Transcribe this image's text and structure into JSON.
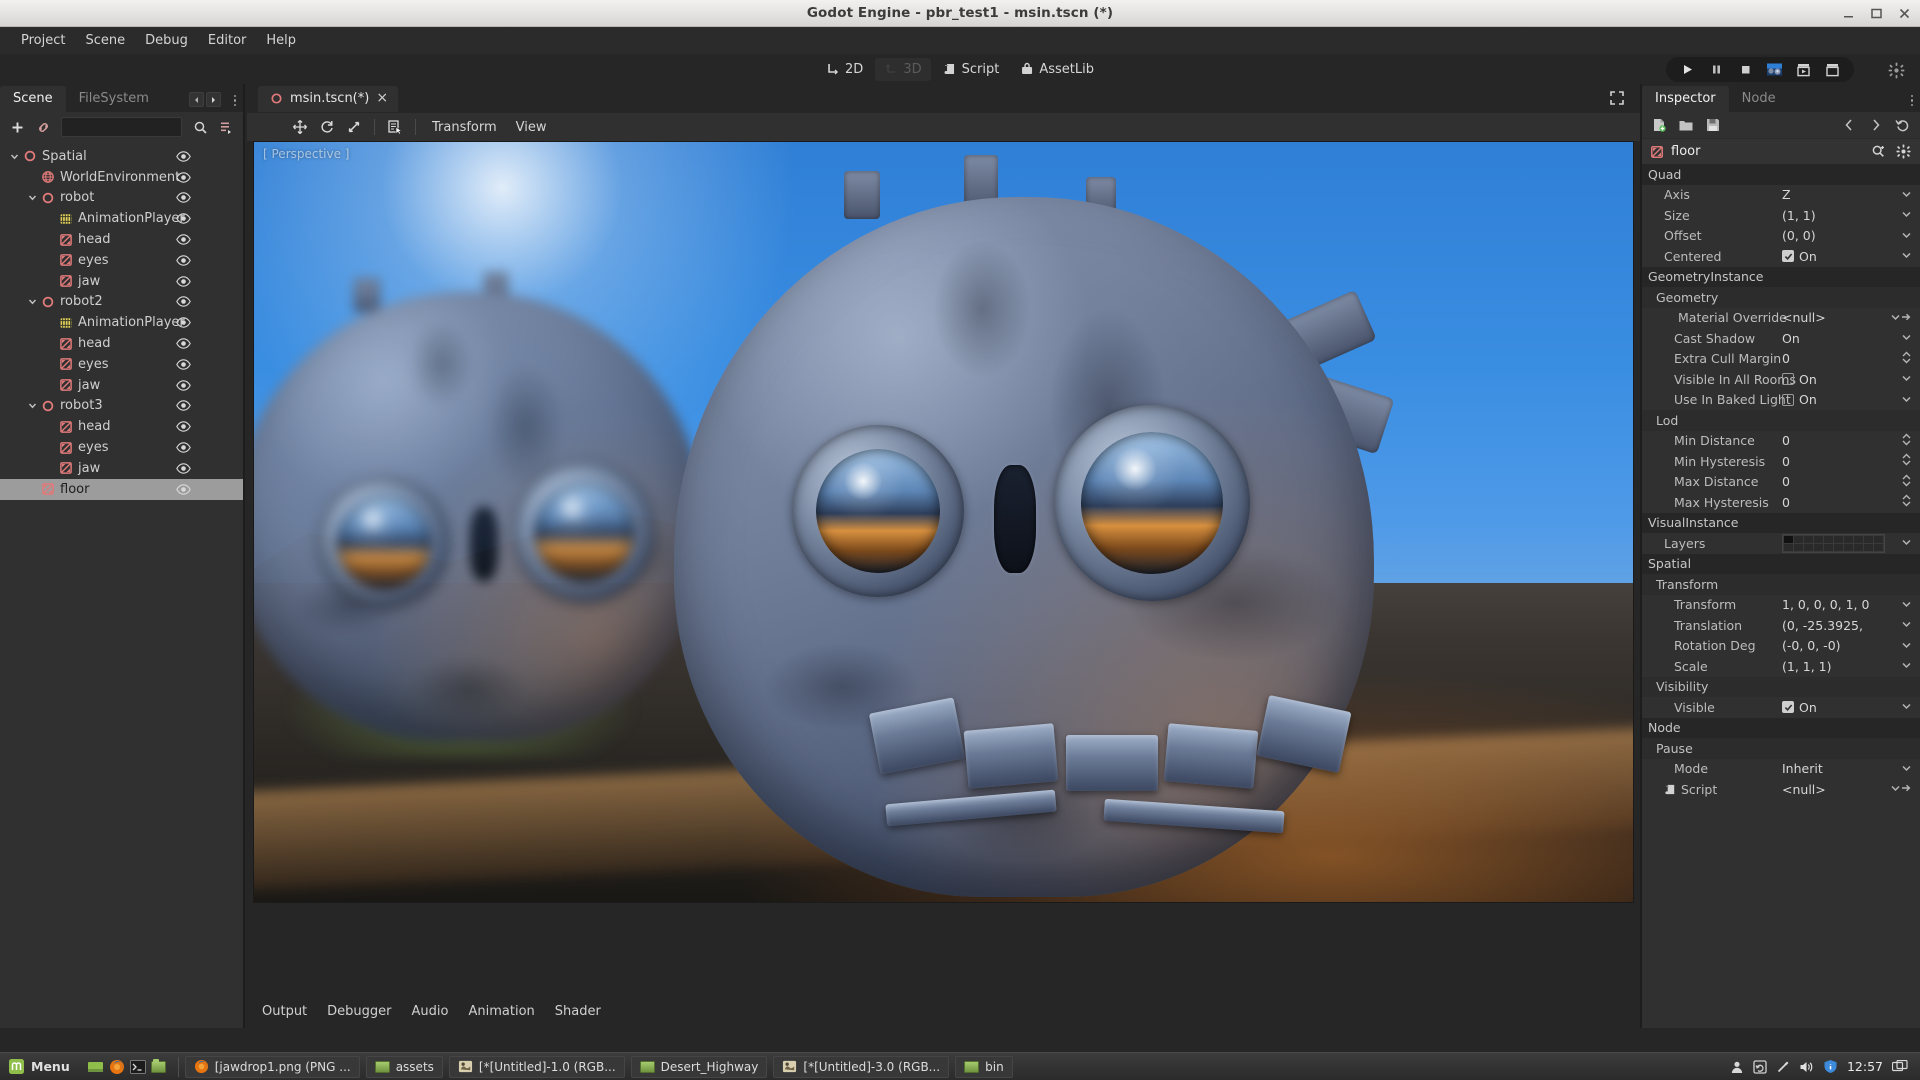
{
  "window": {
    "title": "Godot Engine - pbr_test1 - msin.tscn (*)",
    "minimize": "minimize-button",
    "maximize": "maximize-button",
    "close": "close-button"
  },
  "menubar": {
    "items": [
      {
        "label": "Project"
      },
      {
        "label": "Scene"
      },
      {
        "label": "Debug"
      },
      {
        "label": "Editor"
      },
      {
        "label": "Help"
      }
    ]
  },
  "main_tabs": {
    "items": [
      {
        "label": "2D",
        "icon": "2d-icon",
        "active": false
      },
      {
        "label": "3D",
        "icon": "3d-icon",
        "active": true
      },
      {
        "label": "Script",
        "icon": "script-icon",
        "active": false
      },
      {
        "label": "AssetLib",
        "icon": "assetlib-icon",
        "active": false
      }
    ]
  },
  "playback": {
    "buttons": [
      {
        "name": "play-button",
        "icon": "play-icon"
      },
      {
        "name": "pause-button",
        "icon": "pause-icon"
      },
      {
        "name": "stop-button",
        "icon": "stop-icon"
      },
      {
        "name": "play-scene-button",
        "icon": "scene-preview-icon"
      },
      {
        "name": "play-custom-scene-button",
        "icon": "film-play-icon"
      },
      {
        "name": "play-current-scene-button",
        "icon": "film-icon"
      }
    ],
    "settings": {
      "name": "editor-settings-button",
      "icon": "gear-spin-icon"
    }
  },
  "left_dock": {
    "tabs": [
      {
        "label": "Scene",
        "active": true
      },
      {
        "label": "FileSystem",
        "active": false
      }
    ],
    "toolbar": {
      "add_node": "add-node-button",
      "link_scene": "instance-scene-button",
      "search_placeholder": "",
      "search_value": "",
      "filter": "filter-button"
    },
    "tree": [
      {
        "label": "Spatial",
        "depth": 0,
        "icon": "spatial-icon",
        "twisty": "open",
        "selected": false
      },
      {
        "label": "WorldEnvironment",
        "depth": 1,
        "icon": "worldenv-icon",
        "twisty": "none",
        "selected": false
      },
      {
        "label": "robot",
        "depth": 1,
        "icon": "spatial-icon",
        "twisty": "open",
        "selected": false
      },
      {
        "label": "AnimationPlayer",
        "depth": 2,
        "icon": "animationplayer-icon",
        "twisty": "none",
        "selected": false
      },
      {
        "label": "head",
        "depth": 2,
        "icon": "meshinstance-icon",
        "twisty": "none",
        "selected": false
      },
      {
        "label": "eyes",
        "depth": 2,
        "icon": "meshinstance-icon",
        "twisty": "none",
        "selected": false
      },
      {
        "label": "jaw",
        "depth": 2,
        "icon": "meshinstance-icon",
        "twisty": "none",
        "selected": false
      },
      {
        "label": "robot2",
        "depth": 1,
        "icon": "spatial-icon",
        "twisty": "open",
        "selected": false
      },
      {
        "label": "AnimationPlayer",
        "depth": 2,
        "icon": "animationplayer-icon",
        "twisty": "none",
        "selected": false
      },
      {
        "label": "head",
        "depth": 2,
        "icon": "meshinstance-icon",
        "twisty": "none",
        "selected": false
      },
      {
        "label": "eyes",
        "depth": 2,
        "icon": "meshinstance-icon",
        "twisty": "none",
        "selected": false
      },
      {
        "label": "jaw",
        "depth": 2,
        "icon": "meshinstance-icon",
        "twisty": "none",
        "selected": false
      },
      {
        "label": "robot3",
        "depth": 1,
        "icon": "spatial-icon",
        "twisty": "open",
        "selected": false
      },
      {
        "label": "head",
        "depth": 2,
        "icon": "meshinstance-icon",
        "twisty": "none",
        "selected": false
      },
      {
        "label": "eyes",
        "depth": 2,
        "icon": "meshinstance-icon",
        "twisty": "none",
        "selected": false
      },
      {
        "label": "jaw",
        "depth": 2,
        "icon": "meshinstance-icon",
        "twisty": "none",
        "selected": false
      },
      {
        "label": "floor",
        "depth": 1,
        "icon": "meshinstance-icon",
        "twisty": "none",
        "selected": true
      }
    ]
  },
  "editor": {
    "scene_tab": {
      "label": "msin.tscn(*)",
      "close": "×",
      "modified": true
    },
    "viewport_toolbar": {
      "tools": [
        "move-tool",
        "rotate-tool",
        "scale-tool",
        "list-select-tool"
      ],
      "menus": [
        {
          "label": "Transform"
        },
        {
          "label": "View"
        }
      ]
    },
    "viewport": {
      "label": "[ Perspective ]"
    }
  },
  "bottom_panel": {
    "tabs": [
      {
        "label": "Output"
      },
      {
        "label": "Debugger"
      },
      {
        "label": "Audio"
      },
      {
        "label": "Animation"
      },
      {
        "label": "Shader"
      }
    ]
  },
  "inspector": {
    "tabs": [
      {
        "label": "Inspector",
        "active": true
      },
      {
        "label": "Node",
        "active": false
      }
    ],
    "toolbar": {
      "new_resource": "new-resource-button",
      "load": "load-resource-button",
      "save": "save-resource-button",
      "back": "‹",
      "forward": "›",
      "history": "history-button"
    },
    "node": {
      "name": "floor",
      "icon": "meshinstance-icon",
      "search": "search-icon",
      "options": "gear-icon"
    },
    "sections": [
      {
        "title": "Quad",
        "type": "category",
        "rows": [
          {
            "name": "Axis",
            "value": "Z",
            "widget": "dropdown",
            "indent": 1
          },
          {
            "name": "Size",
            "value": "(1, 1)",
            "widget": "dropdown",
            "indent": 1
          },
          {
            "name": "Offset",
            "value": "(0, 0)",
            "widget": "dropdown",
            "indent": 1
          },
          {
            "name": "Centered",
            "value": "On",
            "widget": "checkbox",
            "checked": true,
            "indent": 1
          }
        ]
      },
      {
        "title": "GeometryInstance",
        "type": "category",
        "subsections": [
          {
            "title": "Geometry",
            "rows": [
              {
                "name": "Material Override",
                "value": "<null>",
                "widget": "resource",
                "indent": 2,
                "icon": "material-icon"
              },
              {
                "name": "Cast Shadow",
                "value": "On",
                "widget": "dropdown",
                "indent": 2
              },
              {
                "name": "Extra Cull Margin",
                "value": "0",
                "widget": "spinner",
                "indent": 2
              },
              {
                "name": "Visible In All Rooms",
                "value": "On",
                "widget": "checkbox",
                "checked": false,
                "indent": 2
              },
              {
                "name": "Use In Baked Light",
                "value": "On",
                "widget": "checkbox",
                "checked": false,
                "indent": 2
              }
            ]
          },
          {
            "title": "Lod",
            "rows": [
              {
                "name": "Min Distance",
                "value": "0",
                "widget": "spinner",
                "indent": 2
              },
              {
                "name": "Min Hysteresis",
                "value": "0",
                "widget": "spinner",
                "indent": 2
              },
              {
                "name": "Max Distance",
                "value": "0",
                "widget": "spinner",
                "indent": 2
              },
              {
                "name": "Max Hysteresis",
                "value": "0",
                "widget": "spinner",
                "indent": 2
              }
            ]
          }
        ]
      },
      {
        "title": "VisualInstance",
        "type": "category",
        "rows": [
          {
            "name": "Layers",
            "value": "",
            "widget": "layers",
            "indent": 1
          }
        ]
      },
      {
        "title": "Spatial",
        "type": "category",
        "subsections": [
          {
            "title": "Transform",
            "rows": [
              {
                "name": "Transform",
                "value": "1, 0, 0, 0, 1, 0",
                "widget": "dropdown",
                "indent": 2
              },
              {
                "name": "Translation",
                "value": "(0, -25.3925,",
                "widget": "dropdown",
                "indent": 2
              },
              {
                "name": "Rotation Deg",
                "value": "(-0, 0, -0)",
                "widget": "dropdown",
                "indent": 2
              },
              {
                "name": "Scale",
                "value": "(1, 1, 1)",
                "widget": "dropdown",
                "indent": 2
              }
            ]
          },
          {
            "title": "Visibility",
            "rows": [
              {
                "name": "Visible",
                "value": "On",
                "widget": "checkbox",
                "checked": true,
                "indent": 2
              }
            ]
          }
        ]
      },
      {
        "title": "Node",
        "type": "category",
        "subsections": [
          {
            "title": "Pause",
            "rows": [
              {
                "name": "Mode",
                "value": "Inherit",
                "widget": "dropdown",
                "indent": 2
              }
            ]
          }
        ],
        "rows_after": [
          {
            "name": "Script",
            "value": "<null>",
            "widget": "resource",
            "indent": 1,
            "icon": "script-icon"
          }
        ]
      }
    ]
  },
  "taskbar": {
    "menu_label": "Menu",
    "launchers": [
      "show-desktop-icon",
      "firefox-icon",
      "terminal-icon",
      "files-icon"
    ],
    "windows": [
      {
        "label": "[jawdrop1.png (PNG ...",
        "icon": "firefox-icon"
      },
      {
        "label": "assets",
        "icon": "folder-icon"
      },
      {
        "label": "[*[Untitled]-1.0 (RGB...",
        "icon": "gimp-icon"
      },
      {
        "label": "Desert_Highway",
        "icon": "folder-icon"
      },
      {
        "label": "[*[Untitled]-3.0 (RGB...",
        "icon": "gimp-icon"
      },
      {
        "label": "bin",
        "icon": "folder-icon"
      }
    ],
    "tray": [
      "user-icon",
      "update-icon",
      "usb-icon",
      "volume-icon",
      "shield-icon"
    ],
    "clock": "12:57",
    "workspace": "workspace-switcher-icon"
  },
  "colors": {
    "accent_red": "#e07a7a",
    "panel_bg": "#303030",
    "window_bg": "#262626",
    "selection": "#9c9c9c"
  }
}
